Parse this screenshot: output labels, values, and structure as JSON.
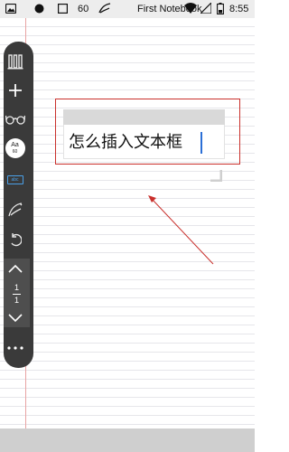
{
  "status_bar": {
    "notification_count": "60",
    "app_title": "First Notebook",
    "time": "8:55"
  },
  "toolbar": {
    "items": [
      {
        "name": "library",
        "icon": "books-icon"
      },
      {
        "name": "add",
        "icon": "plus-icon"
      },
      {
        "name": "reading",
        "icon": "glasses-icon"
      },
      {
        "name": "font",
        "icon": "font-size-icon",
        "label": "Aa",
        "size": "60"
      },
      {
        "name": "text",
        "icon": "text-box-icon",
        "label": "abc"
      },
      {
        "name": "pen",
        "icon": "pen-icon"
      },
      {
        "name": "undo",
        "icon": "undo-icon"
      }
    ],
    "page": {
      "current": "1",
      "total": "1"
    }
  },
  "textbox": {
    "text": "怎么插入文本框"
  },
  "colors": {
    "annotation_red": "#c9302c",
    "caret_blue": "#2b6fd6",
    "toolbar_bg": "#3a3a3a",
    "text_tool_accent": "#4aa0e8"
  }
}
